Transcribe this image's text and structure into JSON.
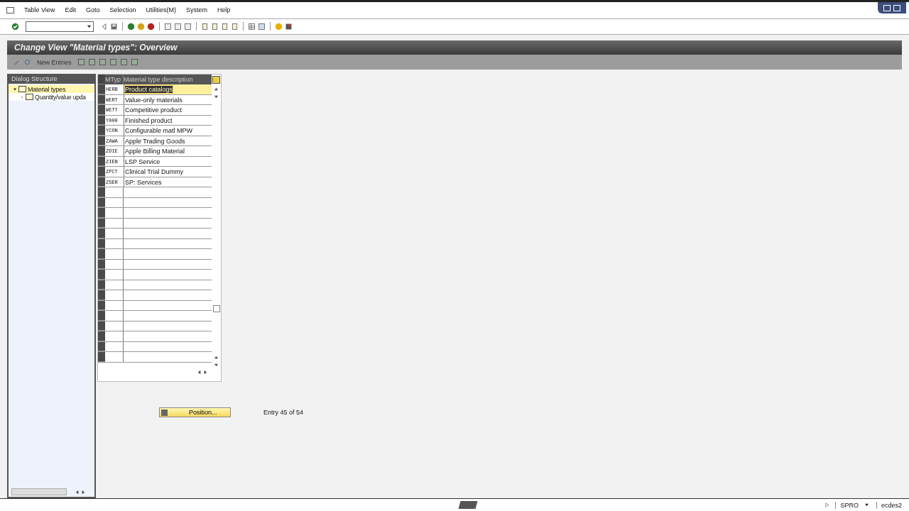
{
  "menu": [
    "Table View",
    "Edit",
    "Goto",
    "Selection",
    "Utilities(M)",
    "System",
    "Help"
  ],
  "title": "Change View \"Material types\": Overview",
  "app_toolbar": {
    "new_entries": "New Entries"
  },
  "dialog_structure": {
    "header": "Dialog Structure",
    "items": [
      {
        "label": "Material types",
        "selected": true,
        "expanded": true,
        "children": [
          {
            "label": "Quantity/value upda",
            "selected": false
          }
        ]
      }
    ]
  },
  "table": {
    "columns": [
      "MTyp",
      "Material type description"
    ],
    "rows": [
      {
        "code": "HERB",
        "description": "Product catalogs",
        "selected": true
      },
      {
        "code": "WERT",
        "description": "Value-only materials",
        "selected": false
      },
      {
        "code": "WETT",
        "description": "Competitive product",
        "selected": false
      },
      {
        "code": "Y000",
        "description": "Finished product",
        "selected": false
      },
      {
        "code": "YCON",
        "description": "Configurable matl MPW",
        "selected": false
      },
      {
        "code": "ZAWA",
        "description": "Apple Trading Goods",
        "selected": false
      },
      {
        "code": "ZDIE",
        "description": "Apple Billing Material",
        "selected": false
      },
      {
        "code": "ZIEN",
        "description": "LSP Service",
        "selected": false
      },
      {
        "code": "ZPCT",
        "description": "Clinical Trial Dummy",
        "selected": false
      },
      {
        "code": "ZSER",
        "description": "SP: Services",
        "selected": false
      }
    ]
  },
  "position_button": "Position...",
  "entry_info": "Entry 45 of 54",
  "status_bar": {
    "transaction": "SPRO",
    "system": "ecdes2"
  }
}
